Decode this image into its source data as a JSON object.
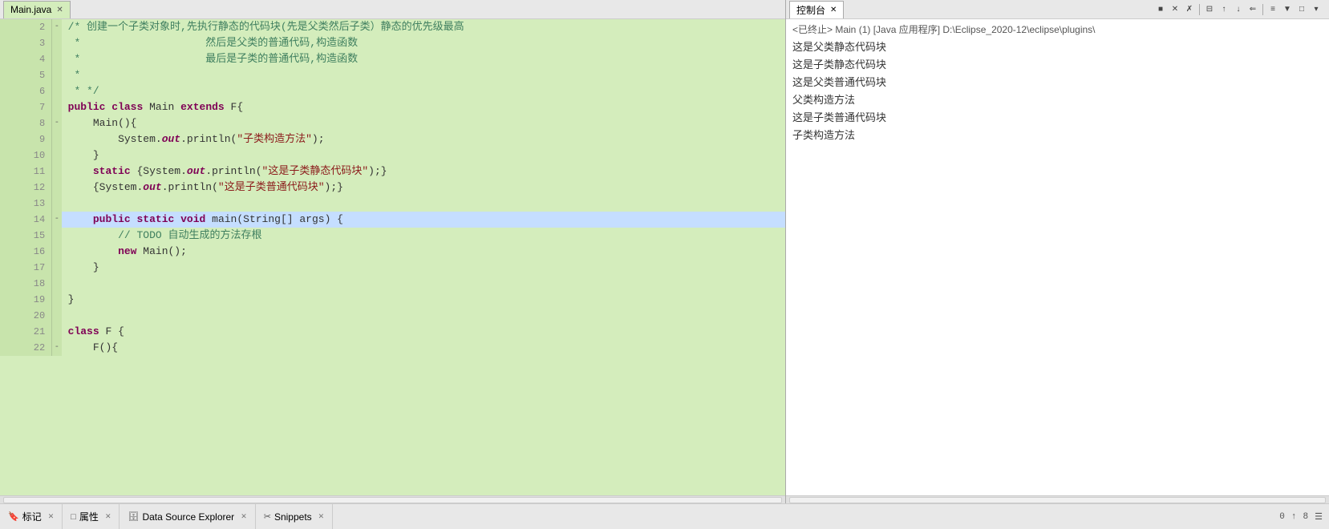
{
  "editor": {
    "tab_label": "Main.java",
    "lines": [
      {
        "num": "2",
        "fold": "-",
        "content": "/* 创建一个子类对象时,先执行静态的代码块(先是父类然后子类）静态的优先级最高",
        "type": "comment"
      },
      {
        "num": "3",
        "fold": "",
        "content": " *                    然后是父类的普通代码,构造函数",
        "type": "comment"
      },
      {
        "num": "4",
        "fold": "",
        "content": " *                    最后是子类的普通代码,构造函数",
        "type": "comment"
      },
      {
        "num": "5",
        "fold": "",
        "content": " *",
        "type": "comment"
      },
      {
        "num": "6",
        "fold": "",
        "content": " * */",
        "type": "comment"
      },
      {
        "num": "7",
        "fold": "",
        "content_parts": [
          {
            "t": "kw",
            "v": "public"
          },
          {
            "t": "plain",
            "v": " "
          },
          {
            "t": "kw",
            "v": "class"
          },
          {
            "t": "plain",
            "v": " Main "
          },
          {
            "t": "kw",
            "v": "extends"
          },
          {
            "t": "plain",
            "v": " F{"
          }
        ],
        "type": "code"
      },
      {
        "num": "8",
        "fold": "-",
        "content_parts": [
          {
            "t": "plain",
            "v": "    Main(){"
          }
        ],
        "type": "code"
      },
      {
        "num": "9",
        "fold": "",
        "content_parts": [
          {
            "t": "plain",
            "v": "        System."
          },
          {
            "t": "italic-out",
            "v": "out"
          },
          {
            "t": "plain",
            "v": ".println("
          },
          {
            "t": "str",
            "v": "\"子类构造方法\""
          },
          {
            "t": "plain",
            "v": ");"
          }
        ],
        "type": "code"
      },
      {
        "num": "10",
        "fold": "",
        "content_parts": [
          {
            "t": "plain",
            "v": "    }"
          }
        ],
        "type": "code"
      },
      {
        "num": "11",
        "fold": "",
        "content_parts": [
          {
            "t": "plain",
            "v": "    "
          },
          {
            "t": "kw",
            "v": "static"
          },
          {
            "t": "plain",
            "v": " {System."
          },
          {
            "t": "italic-out",
            "v": "out"
          },
          {
            "t": "plain",
            "v": ".println("
          },
          {
            "t": "str",
            "v": "\"这是子类静态代码块\""
          },
          {
            "t": "plain",
            "v": ");}"
          }
        ],
        "type": "code"
      },
      {
        "num": "12",
        "fold": "",
        "content_parts": [
          {
            "t": "plain",
            "v": "    {System."
          },
          {
            "t": "italic-out",
            "v": "out"
          },
          {
            "t": "plain",
            "v": ".println("
          },
          {
            "t": "str",
            "v": "\"这是子类普通代码块\""
          },
          {
            "t": "plain",
            "v": ");}"
          }
        ],
        "type": "code"
      },
      {
        "num": "13",
        "fold": "",
        "content_parts": [
          {
            "t": "plain",
            "v": ""
          }
        ],
        "type": "code"
      },
      {
        "num": "14",
        "fold": "-",
        "content_parts": [
          {
            "t": "plain",
            "v": "    "
          },
          {
            "t": "kw",
            "v": "public"
          },
          {
            "t": "plain",
            "v": " "
          },
          {
            "t": "kw",
            "v": "static"
          },
          {
            "t": "plain",
            "v": " "
          },
          {
            "t": "kw",
            "v": "void"
          },
          {
            "t": "plain",
            "v": " main(String[] args) {"
          }
        ],
        "type": "code",
        "highlighted": true
      },
      {
        "num": "15",
        "fold": "",
        "content_parts": [
          {
            "t": "plain",
            "v": "        "
          },
          {
            "t": "cm",
            "v": "// TODO 自动生成的方法存根"
          }
        ],
        "type": "code"
      },
      {
        "num": "16",
        "fold": "",
        "content_parts": [
          {
            "t": "plain",
            "v": "        "
          },
          {
            "t": "kw",
            "v": "new"
          },
          {
            "t": "plain",
            "v": " Main();"
          }
        ],
        "type": "code"
      },
      {
        "num": "17",
        "fold": "",
        "content_parts": [
          {
            "t": "plain",
            "v": "    }"
          }
        ],
        "type": "code"
      },
      {
        "num": "18",
        "fold": "",
        "content_parts": [
          {
            "t": "plain",
            "v": ""
          }
        ],
        "type": "code"
      },
      {
        "num": "19",
        "fold": "",
        "content_parts": [
          {
            "t": "plain",
            "v": "}"
          }
        ],
        "type": "code"
      },
      {
        "num": "20",
        "fold": "",
        "content_parts": [
          {
            "t": "plain",
            "v": ""
          }
        ],
        "type": "code"
      },
      {
        "num": "21",
        "fold": "",
        "content_parts": [
          {
            "t": "kw",
            "v": "class"
          },
          {
            "t": "plain",
            "v": " F {"
          }
        ],
        "type": "code"
      },
      {
        "num": "22",
        "fold": "-",
        "content_parts": [
          {
            "t": "plain",
            "v": "    F(){"
          }
        ],
        "type": "code"
      }
    ]
  },
  "console": {
    "tab_label": "控制台",
    "header": "<已终止> Main (1)  [Java 应用程序] D:\\Eclipse_2020-12\\eclipse\\plugins\\",
    "lines": [
      "这是父类静态代码块",
      "这是子类静态代码块",
      "这是父类普通代码块",
      "父类构造方法",
      "这是子类普通代码块",
      "子类构造方法"
    ],
    "toolbar_icons": [
      "■",
      "✕",
      "✗",
      "⊟",
      "↑",
      "↓",
      "⇐",
      "≡",
      "▼",
      "□",
      "▾"
    ]
  },
  "bottom_bar": {
    "tabs": [
      {
        "label": "标记",
        "icon": "🔖",
        "active": false
      },
      {
        "label": "属性",
        "icon": "□",
        "active": false
      },
      {
        "label": "Data Source Explorer",
        "icon": "🗄",
        "active": false
      },
      {
        "label": "Snippets",
        "icon": "✂",
        "active": false
      }
    ],
    "right_status": "0 ↑  8  ☰"
  }
}
